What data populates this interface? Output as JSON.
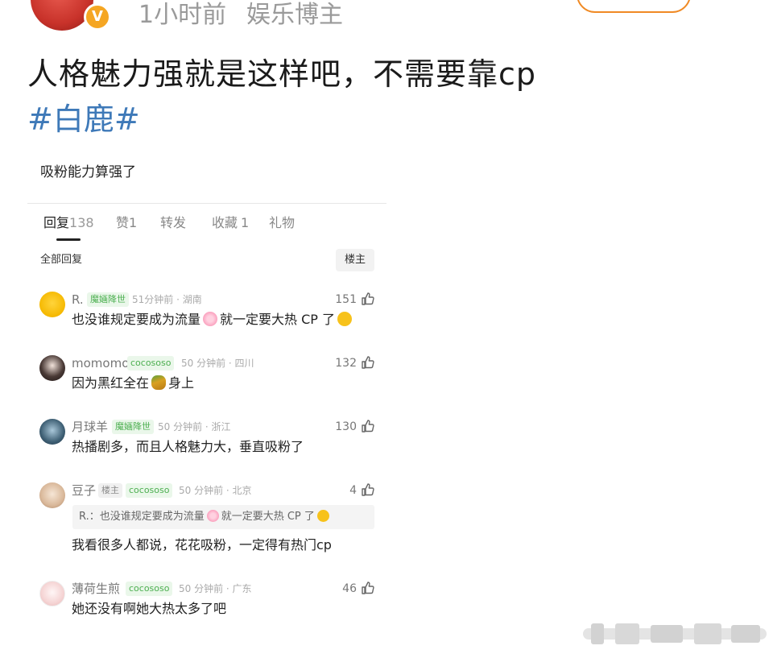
{
  "header": {
    "avatar_icon": "user-avatar-icon",
    "verified_badge": "V",
    "time": "1小时前",
    "category": "娱乐博主"
  },
  "post": {
    "text": "人格魅力强就是这样吧，不需要靠cp",
    "hashtag": "#白鹿#"
  },
  "screenshot": {
    "title": "吸粉能力算强了",
    "tabs": [
      {
        "label": "回复",
        "count": "138"
      },
      {
        "label": "赞",
        "count": "1"
      },
      {
        "label": "转发",
        "count": ""
      },
      {
        "label": "收藏",
        "count": "1"
      },
      {
        "label": "礼物",
        "count": ""
      }
    ],
    "subheading": "全部回复",
    "filter_button": "楼主",
    "comments": [
      {
        "name": "R.",
        "badges": [
          "魔婳降世"
        ],
        "time_location": "51分钟前 · 湖南",
        "likes": "151",
        "text_before": "也没谁规定要成为流量",
        "text_middle": "就一定要大热 CP 了",
        "text_after": ""
      },
      {
        "name": "momomo",
        "badges": [
          "cocososo"
        ],
        "time_location": "50 分钟前 · 四川",
        "likes": "132",
        "text_before": "因为黑红全在",
        "text_middle": "身上",
        "text_after": ""
      },
      {
        "name": "月球羊",
        "badges": [
          "魔婳降世"
        ],
        "time_location": "50 分钟前 · 浙江",
        "likes": "130",
        "text_before": "热播剧多，而且人格魅力大，垂直吸粉了",
        "text_middle": "",
        "text_after": ""
      },
      {
        "name": "豆子",
        "badges": [
          "楼主",
          "cocososo"
        ],
        "time_location": "50 分钟前 · 北京",
        "likes": "4",
        "quote_before": "R.：也没谁规定要成为流量",
        "quote_after": "就一定要大热 CP 了",
        "text_before": "我看很多人都说，花花吸粉，一定得有热门cp",
        "text_middle": "",
        "text_after": ""
      },
      {
        "name": "薄荷生煎",
        "badges": [
          "cocososo"
        ],
        "time_location": "50 分钟前 · 广东",
        "likes": "46",
        "text_before": "她还没有啊她大热太多了吧",
        "text_middle": "",
        "text_after": ""
      }
    ]
  },
  "colors": {
    "hashtag": "#3e79b8",
    "follow_border": "#f08a24",
    "badge_green": "#4caf50",
    "verified": "#f5a623"
  }
}
